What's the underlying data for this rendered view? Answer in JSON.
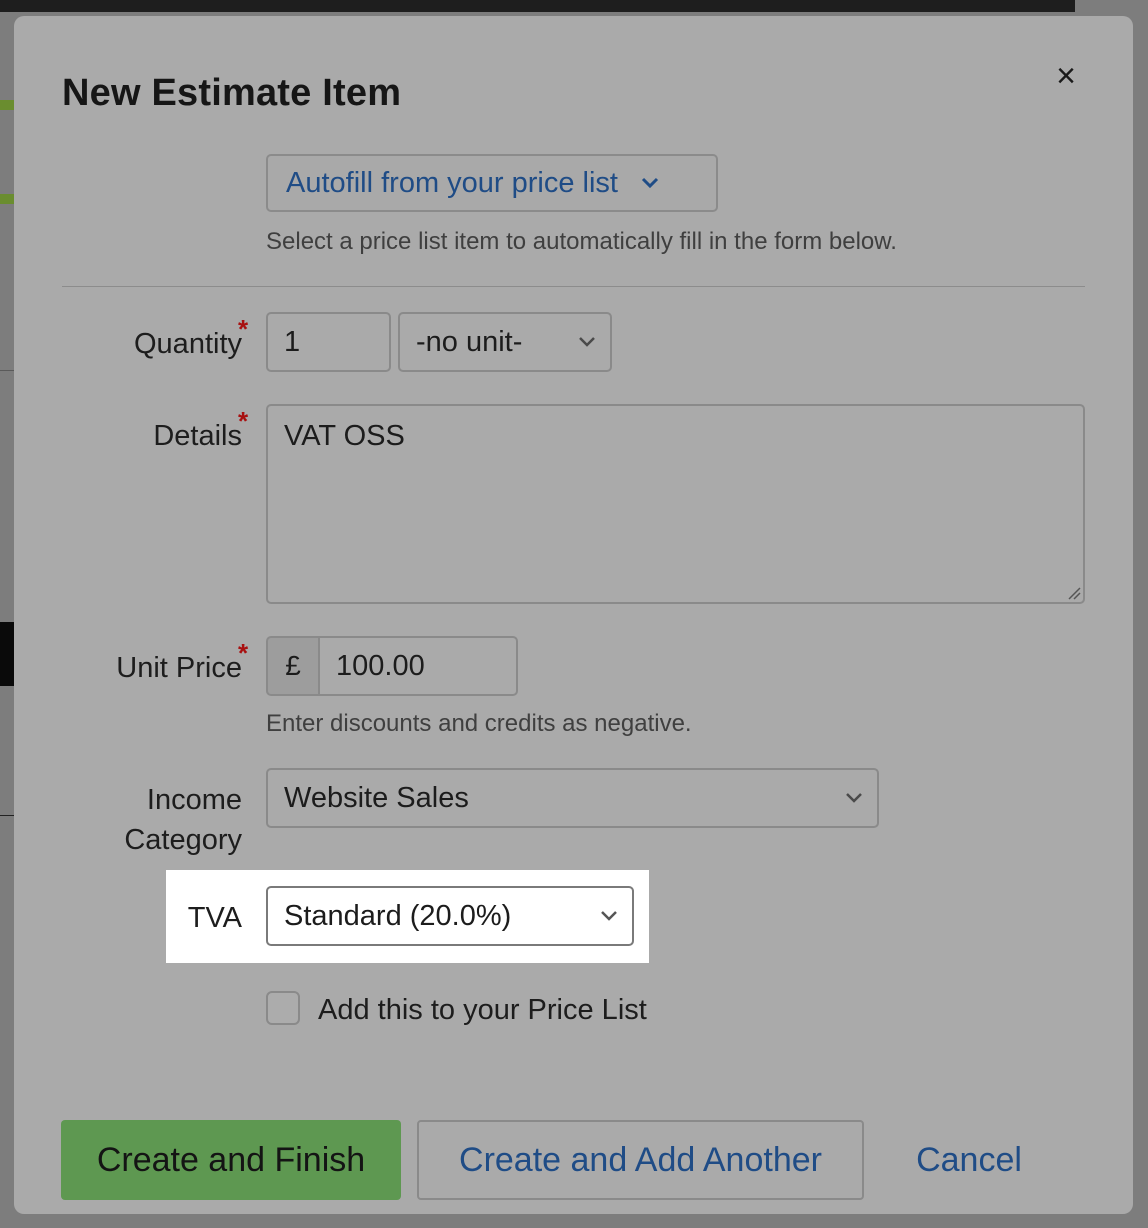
{
  "modal": {
    "title": "New Estimate Item",
    "close_icon": "close-icon"
  },
  "autofill": {
    "label": "Autofill from your price list",
    "hint": "Select a price list item to automatically fill in the form below."
  },
  "quantity": {
    "label": "Quantity",
    "required_mark": "*",
    "value": "1",
    "unit_selected": "-no unit-"
  },
  "details": {
    "label": "Details",
    "required_mark": "*",
    "value": "VAT OSS"
  },
  "unit_price": {
    "label": "Unit Price",
    "required_mark": "*",
    "currency_symbol": "£",
    "value": "100.00",
    "hint": "Enter discounts and credits as negative."
  },
  "income_category": {
    "label_line1": "Income",
    "label_line2": "Category",
    "selected": "Website Sales"
  },
  "tva": {
    "label": "TVA",
    "selected": "Standard (20.0%)"
  },
  "price_list_checkbox": {
    "label": "Add this to your Price List",
    "checked": false
  },
  "actions": {
    "create_finish": "Create and Finish",
    "create_add_another": "Create and Add Another",
    "cancel": "Cancel"
  },
  "colors": {
    "primary_button": "#5e9851",
    "link_blue": "#1f4c86",
    "required_red": "#a81010",
    "overlay_modal": "#aaaaaa"
  }
}
